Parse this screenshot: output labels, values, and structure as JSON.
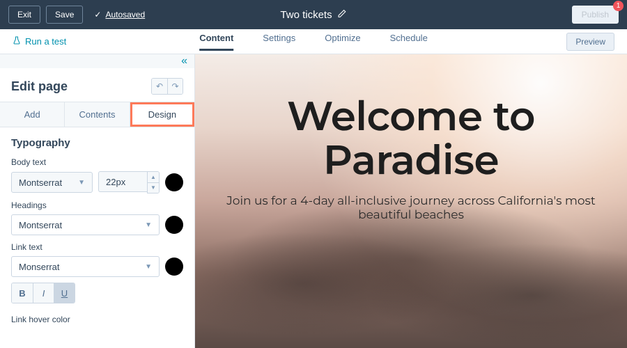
{
  "topbar": {
    "exit": "Exit",
    "save": "Save",
    "autosaved": "Autosaved",
    "title": "Two tickets",
    "publish": "Publish",
    "badge": "1"
  },
  "subnav": {
    "run_test": "Run a test",
    "tabs": [
      "Content",
      "Settings",
      "Optimize",
      "Schedule"
    ],
    "active_tab": 0,
    "preview": "Preview"
  },
  "sidebar": {
    "title": "Edit page",
    "tabs": [
      "Add",
      "Contents",
      "Design"
    ],
    "active_tab": 2,
    "typography": {
      "section_title": "Typography",
      "body_text_label": "Body text",
      "body_font": "Montserrat",
      "body_size": "22px",
      "body_color": "#000000",
      "headings_label": "Headings",
      "headings_font": "Montserrat",
      "headings_color": "#000000",
      "link_text_label": "Link text",
      "link_font": "Monserrat",
      "link_color": "#000000",
      "link_hover_label": "Link hover color"
    }
  },
  "canvas": {
    "hero_title": "Welcome to Paradise",
    "hero_sub": "Join us for a 4-day all-inclusive journey across California's most beautiful beaches"
  }
}
